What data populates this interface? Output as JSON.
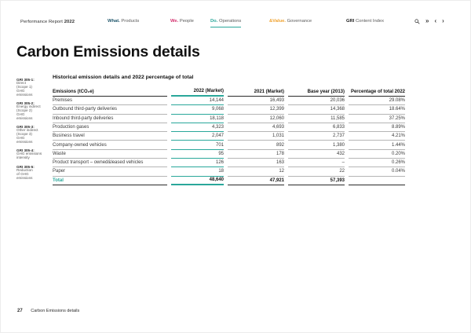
{
  "colors": {
    "teal": "#2aa79a",
    "pink": "#d4306e",
    "orange": "#efa12d",
    "deepblue": "#1f566b",
    "ink": "#1a1a1a",
    "graytext": "#5a5a5a",
    "rulegray": "#b5b5b5",
    "ruledark": "#2a2a2a"
  },
  "nav": {
    "report": {
      "prefix": "Performance Report",
      "year": "2022"
    },
    "items": [
      {
        "prefix": "What.",
        "label": "Products",
        "color": "#1f566b"
      },
      {
        "prefix": "We.",
        "label": "People",
        "color": "#d4306e"
      },
      {
        "prefix": "Do.",
        "label": "Operations",
        "color": "#2aa79a"
      },
      {
        "prefix": "&Value.",
        "label": "Governance",
        "color": "#efa12d"
      },
      {
        "prefix": "GRI",
        "label": "Content Index",
        "color": "#1a1a1a"
      }
    ],
    "icons": {
      "skip": "»",
      "prev": "‹",
      "next": "›"
    }
  },
  "page_title": "Carbon Emissions details",
  "sidebar_notes": [
    {
      "code": "GRI 305-1:",
      "body": "Direct\n(Scope 1)\nGHG\nemissions"
    },
    {
      "code": "GRI 305-2:",
      "body": "Energy indirect\n(Scope 2)\nGHG\nemissions"
    },
    {
      "code": "GRI 305-3:",
      "body": "Other indirect\n(Scope 3)\nGHG\nemissions"
    },
    {
      "code": "GRI 305-4:",
      "body": "GHG emissions\nintensity"
    },
    {
      "code": "GRI 305-5:",
      "body": "Reduction\nof GHG\nemissions"
    }
  ],
  "section": {
    "heading": "Historical emission details and 2022 percentage of total"
  },
  "table": {
    "columns": [
      "Emissions (tCO₂e)",
      "2022 (Market)",
      "2021 (Market)",
      "Base year (2013)",
      "Percentage of total 2022"
    ],
    "rows": [
      {
        "label": "Premises",
        "y2022": "14,144",
        "y2021": "16,493",
        "base": "20,036",
        "pct": "29.08%"
      },
      {
        "label": "Outbound third-party deliveries",
        "y2022": "9,068",
        "y2021": "12,399",
        "base": "14,368",
        "pct": "18.64%"
      },
      {
        "label": "Inbound third-party deliveries",
        "y2022": "18,118",
        "y2021": "12,060",
        "base": "11,585",
        "pct": "37.25%"
      },
      {
        "label": "Production gases",
        "y2022": "4,323",
        "y2021": "4,693",
        "base": "6,833",
        "pct": "8.89%"
      },
      {
        "label": "Business travel",
        "y2022": "2,047",
        "y2021": "1,031",
        "base": "2,737",
        "pct": "4.21%"
      },
      {
        "label": "Company-owned vehicles",
        "y2022": "701",
        "y2021": "892",
        "base": "1,380",
        "pct": "1.44%"
      },
      {
        "label": "Waste",
        "y2022": "95",
        "y2021": "178",
        "base": "432",
        "pct": "0.20%"
      },
      {
        "label": "Product transport – owned&leased vehicles",
        "y2022": "126",
        "y2021": "163",
        "base": "–",
        "pct": "0.26%"
      },
      {
        "label": "Paper",
        "y2022": "18",
        "y2021": "12",
        "base": "22",
        "pct": "0.04%"
      }
    ],
    "total": {
      "label": "Total",
      "y2022": "48,640",
      "y2021": "47,921",
      "base": "57,393",
      "pct": ""
    }
  },
  "footer": {
    "page_number": "27",
    "label": "Carbon Emissions details"
  }
}
